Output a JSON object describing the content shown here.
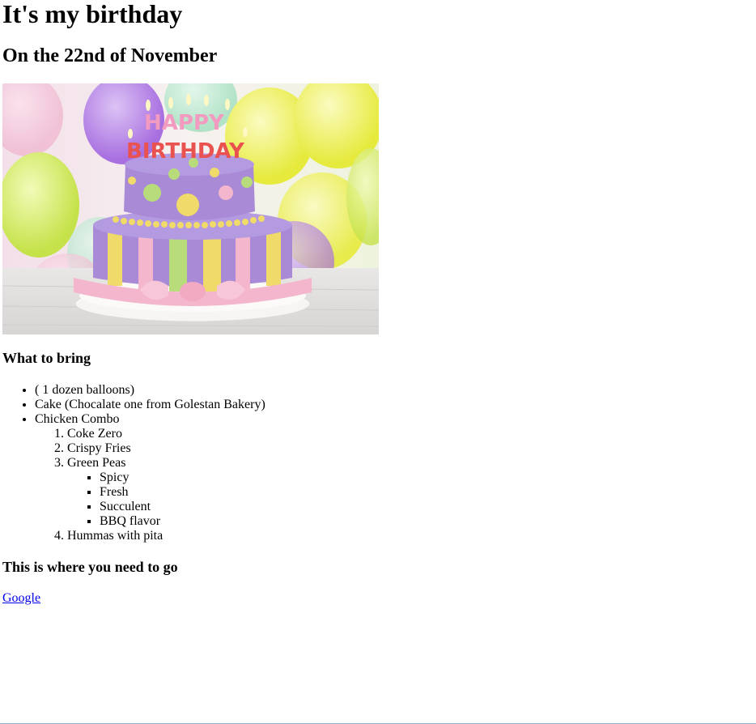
{
  "title": "It's my birthday",
  "subtitle": "On the 22nd of November",
  "image": {
    "cake_letters_top": "HAPPY",
    "cake_letters_bottom": "BIRTHDAY",
    "colors": {
      "background_balloons": [
        "#c9a6e8",
        "#f2f07a",
        "#b8e6c8",
        "#f7c6d8",
        "#e8f4a0"
      ],
      "cake_purple": "#a98ad6",
      "cake_yellow": "#f0da6a",
      "cake_pink": "#f4b6cc",
      "cake_green": "#b9dc7a",
      "plate": "#f4f1ee"
    }
  },
  "bring_section": {
    "heading": "What to bring",
    "items": [
      {
        "label": "( 1 dozen balloons)"
      },
      {
        "label": "Cake (Chocalate one from Golestan Bakery)"
      },
      {
        "label": "Chicken Combo",
        "sub_items": [
          {
            "label": "Coke Zero"
          },
          {
            "label": "Crispy Fries"
          },
          {
            "label": "Green Peas",
            "sub_items": [
              {
                "label": "Spicy"
              },
              {
                "label": "Fresh"
              },
              {
                "label": "Succulent"
              },
              {
                "label": "BBQ flavor"
              }
            ]
          },
          {
            "label": "Hummas with pita"
          }
        ]
      }
    ]
  },
  "go_section": {
    "heading": "This is where you need to go",
    "link_text": "Google",
    "link_color": "#0000ee"
  }
}
